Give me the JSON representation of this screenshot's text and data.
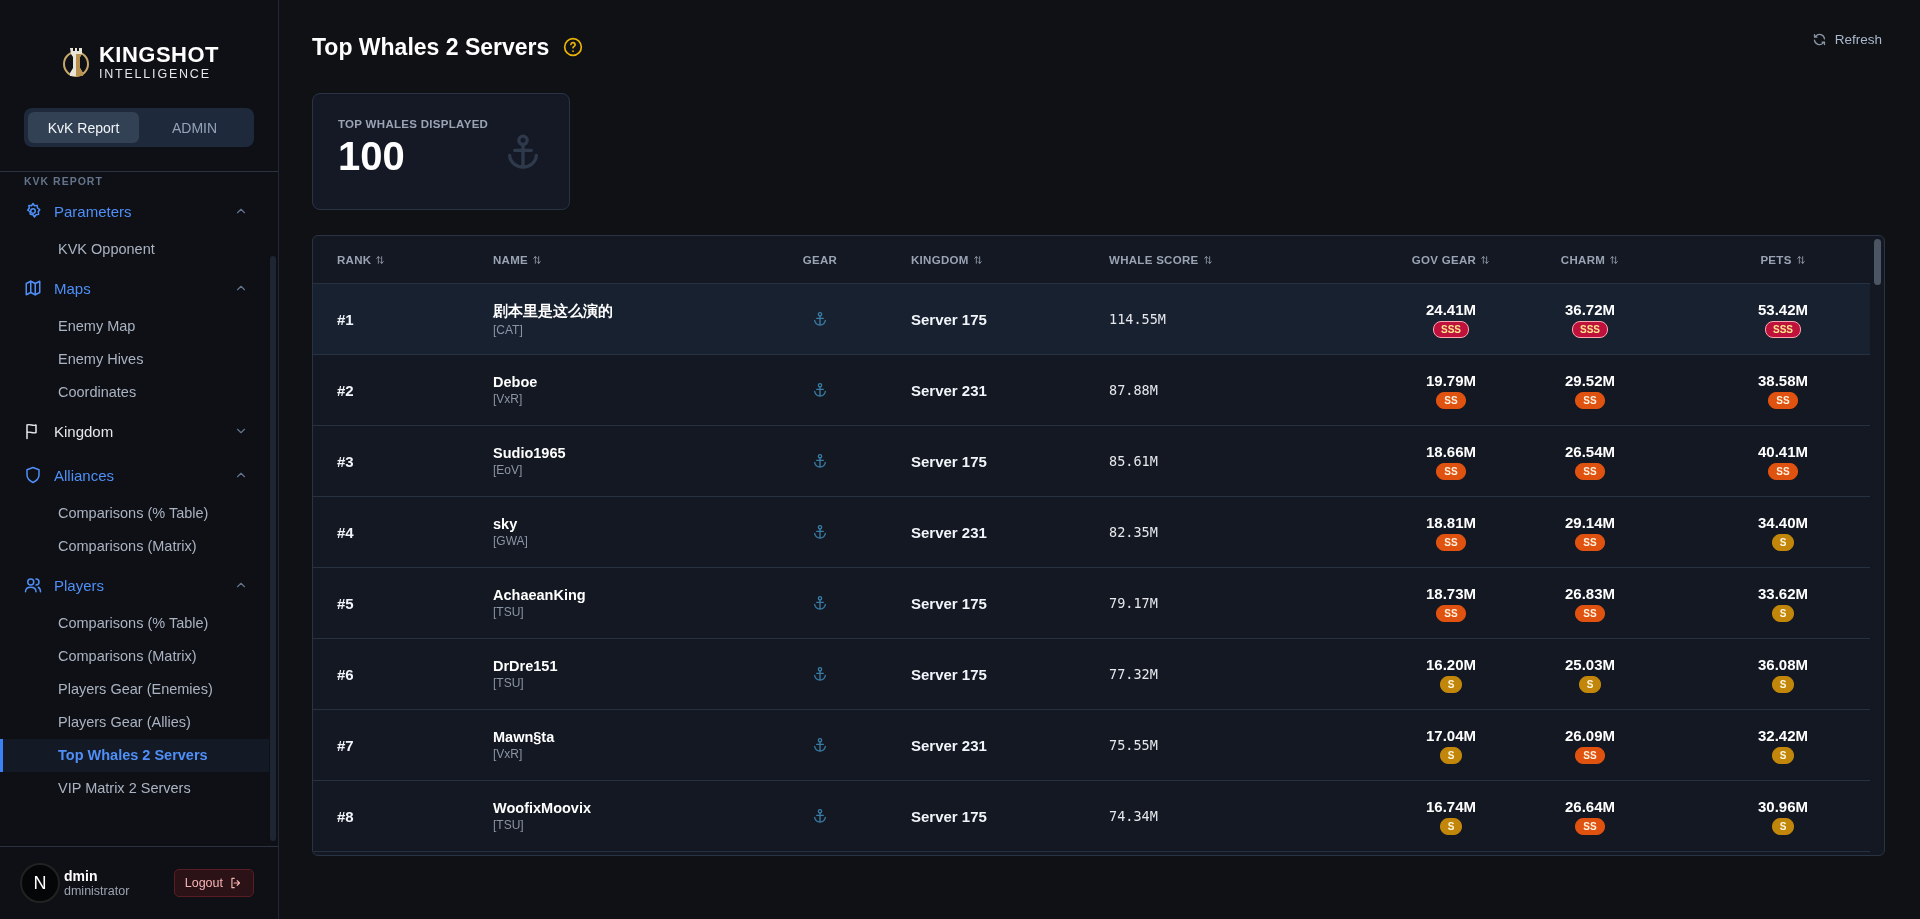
{
  "sidebar": {
    "logo": {
      "title": "KINGSHOT",
      "subtitle": "INTELLIGENCE"
    },
    "mode_tabs": [
      {
        "label": "KvK Report",
        "selected": true
      },
      {
        "label": "ADMIN",
        "selected": false
      }
    ],
    "section_label": "KVK REPORT",
    "groups": [
      {
        "label": "Parameters",
        "expanded": true,
        "items": [
          {
            "label": "KVK Opponent",
            "selected": false
          }
        ]
      },
      {
        "label": "Maps",
        "expanded": true,
        "items": [
          {
            "label": "Enemy Map",
            "selected": false
          },
          {
            "label": "Enemy Hives",
            "selected": false
          },
          {
            "label": "Coordinates",
            "selected": false
          }
        ]
      },
      {
        "label": "Kingdom",
        "expanded": false
      },
      {
        "label": "Alliances",
        "expanded": true,
        "items": [
          {
            "label": "Comparisons (% Table)",
            "selected": false
          },
          {
            "label": "Comparisons (Matrix)",
            "selected": false
          }
        ]
      },
      {
        "label": "Players",
        "expanded": true,
        "items": [
          {
            "label": "Comparisons (% Table)",
            "selected": false
          },
          {
            "label": "Comparisons (Matrix)",
            "selected": false
          },
          {
            "label": "Players Gear (Enemies)",
            "selected": false
          },
          {
            "label": "Players Gear (Allies)",
            "selected": false
          },
          {
            "label": "Top Whales 2 Servers",
            "selected": true
          },
          {
            "label": "VIP Matrix 2 Servers",
            "selected": false
          }
        ]
      }
    ],
    "user": {
      "avatar": "N",
      "name": "dmin",
      "role": "dministrator"
    },
    "logout": "Logout"
  },
  "header": {
    "title": "Top Whales 2 Servers",
    "refresh": "Refresh"
  },
  "stat_card": {
    "label": "TOP WHALES DISPLAYED",
    "value": "100"
  },
  "table": {
    "columns": [
      {
        "label": "RANK",
        "sortable": true
      },
      {
        "label": "NAME",
        "sortable": true
      },
      {
        "label": "GEAR",
        "sortable": false
      },
      {
        "label": "KINGDOM",
        "sortable": true
      },
      {
        "label": "WHALE SCORE",
        "sortable": true
      },
      {
        "label": "GOV GEAR",
        "sortable": true
      },
      {
        "label": "CHARM",
        "sortable": true
      },
      {
        "label": "PETS",
        "sortable": true
      }
    ],
    "rows": [
      {
        "rank": "#1",
        "name": "剧本里是这么演的",
        "tag": "[CAT]",
        "kingdom": "Server 175",
        "whale_score": "114.55M",
        "highlighted": true,
        "stats": [
          {
            "value": "24.41M",
            "tier": "SSS",
            "kind": "sss"
          },
          {
            "value": "36.72M",
            "tier": "SSS",
            "kind": "sss"
          },
          {
            "value": "53.42M",
            "tier": "SSS",
            "kind": "sss"
          }
        ]
      },
      {
        "rank": "#2",
        "name": "Deboe",
        "tag": "[VxR]",
        "kingdom": "Server 231",
        "whale_score": "87.88M",
        "highlighted": false,
        "stats": [
          {
            "value": "19.79M",
            "tier": "SS",
            "kind": "ss"
          },
          {
            "value": "29.52M",
            "tier": "SS",
            "kind": "ss"
          },
          {
            "value": "38.58M",
            "tier": "SS",
            "kind": "ss"
          }
        ]
      },
      {
        "rank": "#3",
        "name": "Sudio1965",
        "tag": "[EoV]",
        "kingdom": "Server 175",
        "whale_score": "85.61M",
        "highlighted": false,
        "stats": [
          {
            "value": "18.66M",
            "tier": "SS",
            "kind": "ss"
          },
          {
            "value": "26.54M",
            "tier": "SS",
            "kind": "ss"
          },
          {
            "value": "40.41M",
            "tier": "SS",
            "kind": "ss"
          }
        ]
      },
      {
        "rank": "#4",
        "name": "sky",
        "tag": "[GWA]",
        "kingdom": "Server 231",
        "whale_score": "82.35M",
        "highlighted": false,
        "stats": [
          {
            "value": "18.81M",
            "tier": "SS",
            "kind": "ss"
          },
          {
            "value": "29.14M",
            "tier": "SS",
            "kind": "ss"
          },
          {
            "value": "34.40M",
            "tier": "S",
            "kind": "s"
          }
        ]
      },
      {
        "rank": "#5",
        "name": "AchaeanKing",
        "tag": "[TSU]",
        "kingdom": "Server 175",
        "whale_score": "79.17M",
        "highlighted": false,
        "stats": [
          {
            "value": "18.73M",
            "tier": "SS",
            "kind": "ss"
          },
          {
            "value": "26.83M",
            "tier": "SS",
            "kind": "ss"
          },
          {
            "value": "33.62M",
            "tier": "S",
            "kind": "s"
          }
        ]
      },
      {
        "rank": "#6",
        "name": "DrDre151",
        "tag": "[TSU]",
        "kingdom": "Server 175",
        "whale_score": "77.32M",
        "highlighted": false,
        "stats": [
          {
            "value": "16.20M",
            "tier": "S",
            "kind": "s"
          },
          {
            "value": "25.03M",
            "tier": "S",
            "kind": "s"
          },
          {
            "value": "36.08M",
            "tier": "S",
            "kind": "s"
          }
        ]
      },
      {
        "rank": "#7",
        "name": "Mawn§ta",
        "tag": "[VxR]",
        "kingdom": "Server 231",
        "whale_score": "75.55M",
        "highlighted": false,
        "stats": [
          {
            "value": "17.04M",
            "tier": "S",
            "kind": "s"
          },
          {
            "value": "26.09M",
            "tier": "SS",
            "kind": "ss"
          },
          {
            "value": "32.42M",
            "tier": "S",
            "kind": "s"
          }
        ]
      },
      {
        "rank": "#8",
        "name": "WoofixMoovix",
        "tag": "[TSU]",
        "kingdom": "Server 175",
        "whale_score": "74.34M",
        "highlighted": false,
        "stats": [
          {
            "value": "16.74M",
            "tier": "S",
            "kind": "s"
          },
          {
            "value": "26.64M",
            "tier": "SS",
            "kind": "ss"
          },
          {
            "value": "30.96M",
            "tier": "S",
            "kind": "s"
          }
        ]
      }
    ]
  }
}
